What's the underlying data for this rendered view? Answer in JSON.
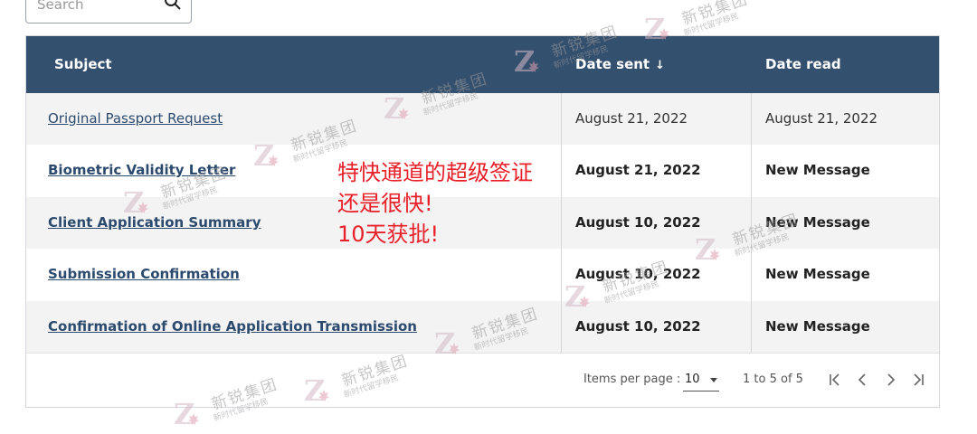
{
  "search": {
    "placeholder": "Search"
  },
  "table": {
    "headers": {
      "subject": "Subject",
      "date_sent": "Date sent",
      "date_read": "Date read",
      "sort_arrow": "↓"
    },
    "rows": [
      {
        "subject": "Original Passport Request",
        "date_sent": "August 21, 2022",
        "date_read": "August 21, 2022"
      },
      {
        "subject": "Biometric Validity Letter",
        "date_sent": "August 21, 2022",
        "date_read": "New Message"
      },
      {
        "subject": "Client Application Summary",
        "date_sent": "August 10, 2022",
        "date_read": "New Message"
      },
      {
        "subject": "Submission Confirmation",
        "date_sent": "August 10, 2022",
        "date_read": "New Message"
      },
      {
        "subject": "Confirmation of Online Application Transmission",
        "date_sent": "August 10, 2022",
        "date_read": "New Message"
      }
    ]
  },
  "pagination": {
    "items_per_page_label": "Items per page :",
    "items_per_page": "10",
    "range": "1 to 5 of 5",
    "first": "|<",
    "prev": "<",
    "next": ">",
    "last": ">|"
  },
  "annotation": {
    "line1": "特快通道的超级签证",
    "line2": "还是很快!",
    "line3": "10天获批!"
  },
  "watermark": {
    "name": "新锐集团",
    "tagline": "新时代留学移民"
  },
  "colors": {
    "header_bg": "#34506f",
    "link": "#2c4a6e",
    "annotation": "#e8202a"
  }
}
